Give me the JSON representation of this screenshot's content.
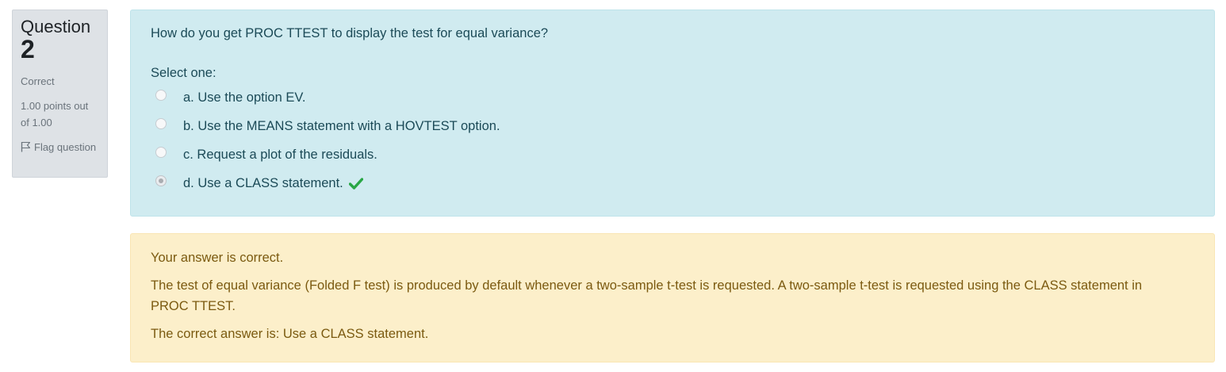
{
  "info": {
    "question_word": "Question",
    "question_number": "2",
    "state": "Correct",
    "grade": "1.00 points out of 1.00",
    "flag_label": "Flag question",
    "flag_icon": "flag-icon"
  },
  "question": {
    "text": "How do you get PROC TTEST to display the test for equal variance?",
    "prompt": "Select one:",
    "options": [
      {
        "label": "a. Use the option EV.",
        "selected": false
      },
      {
        "label": "b. Use the MEANS statement with a HOVTEST option.",
        "selected": false
      },
      {
        "label": "c. Request a plot of the residuals.",
        "selected": false
      },
      {
        "label": "d. Use a CLASS statement.",
        "selected": true,
        "mark_icon": "check-icon"
      }
    ]
  },
  "feedback": {
    "result": "Your answer is correct.",
    "general": "The test of equal variance (Folded F test) is produced by default whenever a two-sample t-test is requested. A two-sample t-test is requested using the CLASS statement in PROC TTEST.",
    "right_answer": "The correct answer is: Use a CLASS statement."
  },
  "colors": {
    "info_bg": "#dee2e6",
    "question_bg": "#d0ebf0",
    "feedback_bg": "#fcefca",
    "correct_check": "#28a745"
  }
}
